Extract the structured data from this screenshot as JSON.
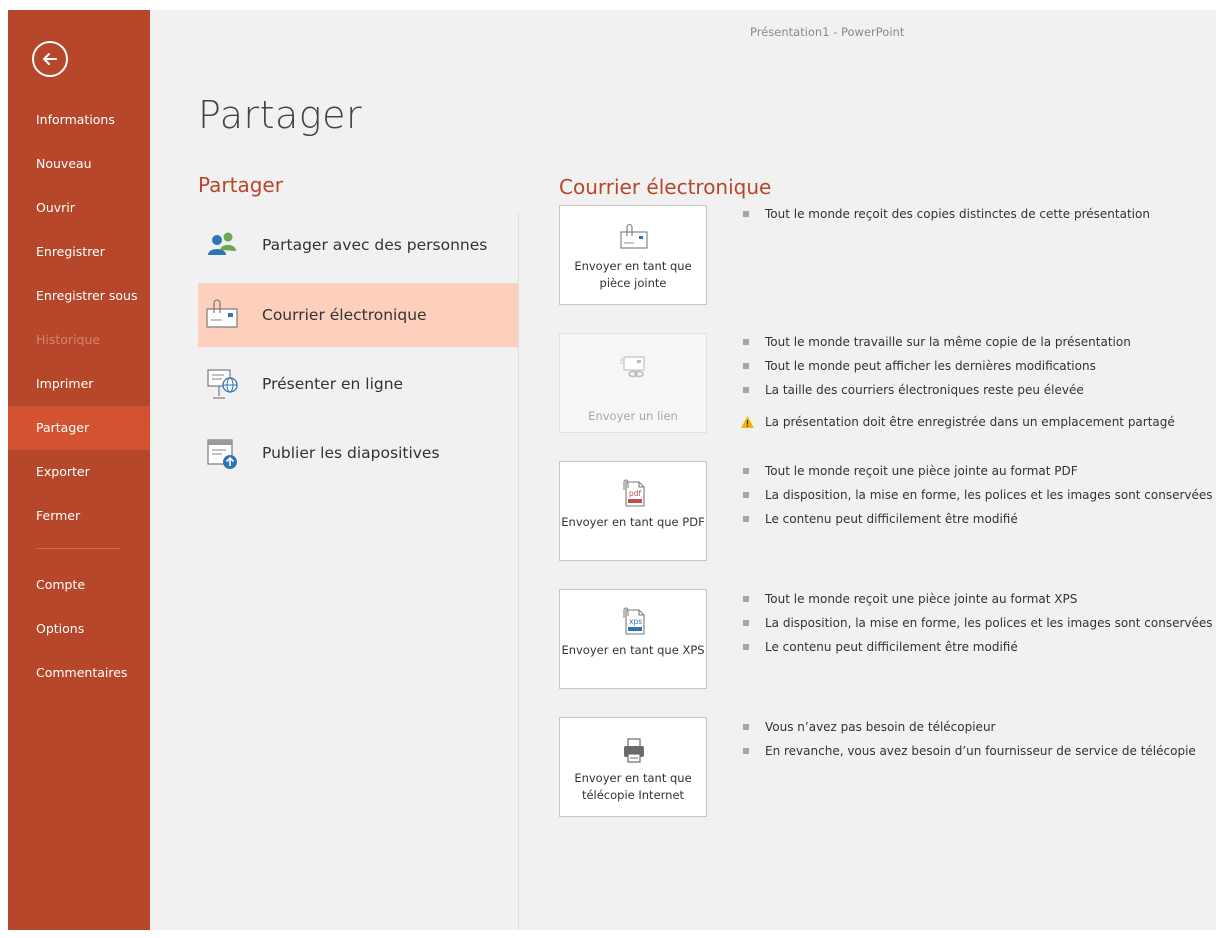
{
  "window": {
    "title": "Présentation1 - PowerPoint"
  },
  "nav": {
    "items": [
      {
        "label": "Informations"
      },
      {
        "label": "Nouveau"
      },
      {
        "label": "Ouvrir"
      },
      {
        "label": "Enregistrer"
      },
      {
        "label": "Enregistrer sous"
      },
      {
        "label": "Historique"
      },
      {
        "label": "Imprimer"
      },
      {
        "label": "Partager"
      },
      {
        "label": "Exporter"
      },
      {
        "label": "Fermer"
      },
      {
        "label": "Compte"
      },
      {
        "label": "Options"
      },
      {
        "label": "Commentaires"
      }
    ],
    "active_label": "Partager",
    "disabled_label": "Historique"
  },
  "page": {
    "title": "Partager"
  },
  "share": {
    "heading": "Partager",
    "options": [
      {
        "label": "Partager avec des personnes",
        "icon": "people-icon"
      },
      {
        "label": "Courrier électronique",
        "icon": "email-icon"
      },
      {
        "label": "Présenter en ligne",
        "icon": "present-online-icon"
      },
      {
        "label": "Publier les diapositives",
        "icon": "publish-slides-icon"
      }
    ],
    "selected_label": "Courrier électronique"
  },
  "email": {
    "heading": "Courrier électronique",
    "actions": [
      {
        "label": "Envoyer en tant que pièce jointe",
        "icon": "attachment-envelope-icon",
        "bullets": [
          "Tout le monde reçoit des copies distinctes de cette présentation"
        ]
      },
      {
        "label": "Envoyer un lien",
        "icon": "link-envelope-icon",
        "disabled": true,
        "bullets": [
          "Tout le monde travaille sur la même copie de la présentation",
          "Tout le monde peut afficher les dernières modifications",
          "La taille des courriers électroniques reste peu élevée"
        ],
        "warning": "La présentation doit être enregistrée dans un emplacement partagé"
      },
      {
        "label": "Envoyer en tant que PDF",
        "icon": "pdf-icon",
        "bullets": [
          "Tout le monde reçoit une pièce jointe au format PDF",
          "La disposition, la mise en forme, les polices et les images sont conservées",
          "Le contenu peut difficilement être modifié"
        ]
      },
      {
        "label": "Envoyer en tant que XPS",
        "icon": "xps-icon",
        "bullets": [
          "Tout le monde reçoit une pièce jointe au format XPS",
          "La disposition, la mise en forme, les polices et les images sont conservées",
          "Le contenu peut difficilement être modifié"
        ]
      },
      {
        "label": "Envoyer en tant que télécopie Internet",
        "icon": "fax-icon",
        "bullets": [
          "Vous n’avez pas besoin de télécopieur",
          "En revanche, vous avez besoin d’un fournisseur de service de télécopie"
        ]
      }
    ]
  },
  "colors": {
    "nav_bg": "#b7472a",
    "nav_active": "#d35230",
    "accent": "#b7472a",
    "selected_bg": "#fcd0bd",
    "main_bg": "#f1f1f1"
  }
}
